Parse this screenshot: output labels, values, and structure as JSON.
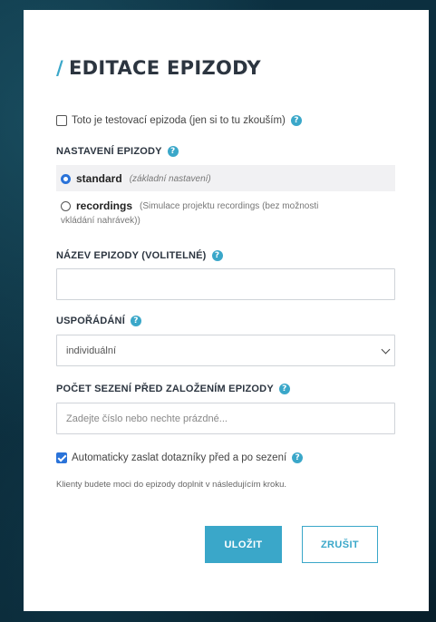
{
  "modal": {
    "title": "EDITACE EPIZODY",
    "title_slash": "/",
    "test_episode": {
      "label": "Toto je testovací epizoda (jen si to tu zkouším)",
      "checked": false
    },
    "settings": {
      "label": "NASTAVENÍ EPIZODY",
      "options": [
        {
          "label": "standard",
          "hint": "(základní nastavení)",
          "selected": true
        },
        {
          "label": "recordings",
          "hint_line1": "(Simulace projektu recordings (bez možnosti",
          "hint_line2": "vkládání nahrávek))",
          "selected": false
        }
      ]
    },
    "name": {
      "label": "NÁZEV EPIZODY (VOLITELNÉ)",
      "value": ""
    },
    "arrangement": {
      "label": "USPOŘÁDÁNÍ",
      "selected": "individuální"
    },
    "sessions": {
      "label": "POČET SEZENÍ PŘED ZALOŽENÍM EPIZODY",
      "placeholder": "Zadejte číslo nebo nechte prázdné..."
    },
    "auto_send": {
      "label": "Automaticky zaslat dotazníky před a po sezení",
      "checked": true
    },
    "note": "Klienty budete moci do epizody doplnit v následujícím kroku.",
    "save_label": "ULOŽIT",
    "cancel_label": "ZRUŠIT",
    "help_glyph": "?"
  },
  "colors": {
    "accent": "#3aa7c9",
    "checkbox": "#2a73d9",
    "title": "#2c3540"
  }
}
